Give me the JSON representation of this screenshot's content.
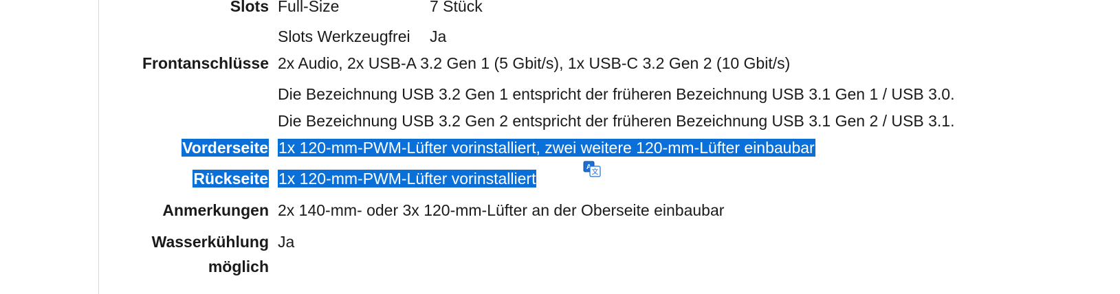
{
  "rows": {
    "slots": {
      "label": "Slots",
      "sub_label": "Full-Size",
      "value": "7 Stück"
    },
    "slots_tool": {
      "sub_label": "Slots Werkzeugfrei",
      "value": "Ja"
    },
    "front_ports": {
      "label": "Frontanschlüsse",
      "value": "2x Audio, 2x USB-A 3.2 Gen 1 (5 Gbit/s), 1x USB-C 3.2 Gen 2 (10 Gbit/s)",
      "note1": "Die Bezeichnung USB 3.2 Gen 1 entspricht der früheren Bezeichnung USB 3.1 Gen 1 / USB 3.0.",
      "note2": "Die Bezeichnung USB 3.2 Gen 2 entspricht der früheren Bezeichnung USB 3.1 Gen 2 / USB 3.1."
    },
    "front": {
      "label": "Vorderseite",
      "value": "1x 120-mm-PWM-Lüfter vorinstalliert, zwei weitere 120-mm-Lüfter einbaubar"
    },
    "back": {
      "label": "Rückseite",
      "value": "1x 120-mm-PWM-Lüfter vorinstalliert"
    },
    "notes": {
      "label": "Anmerkungen",
      "value": "2x 140-mm- oder 3x 120-mm-Lüfter an der Oberseite einbaubar"
    },
    "water": {
      "label_line1": "Wasserkühlung",
      "label_line2": "möglich",
      "value": "Ja"
    }
  },
  "colors": {
    "selection": "#0a6fd6",
    "selection_text": "#ffffff"
  },
  "icons": {
    "translate": "translate-icon"
  }
}
